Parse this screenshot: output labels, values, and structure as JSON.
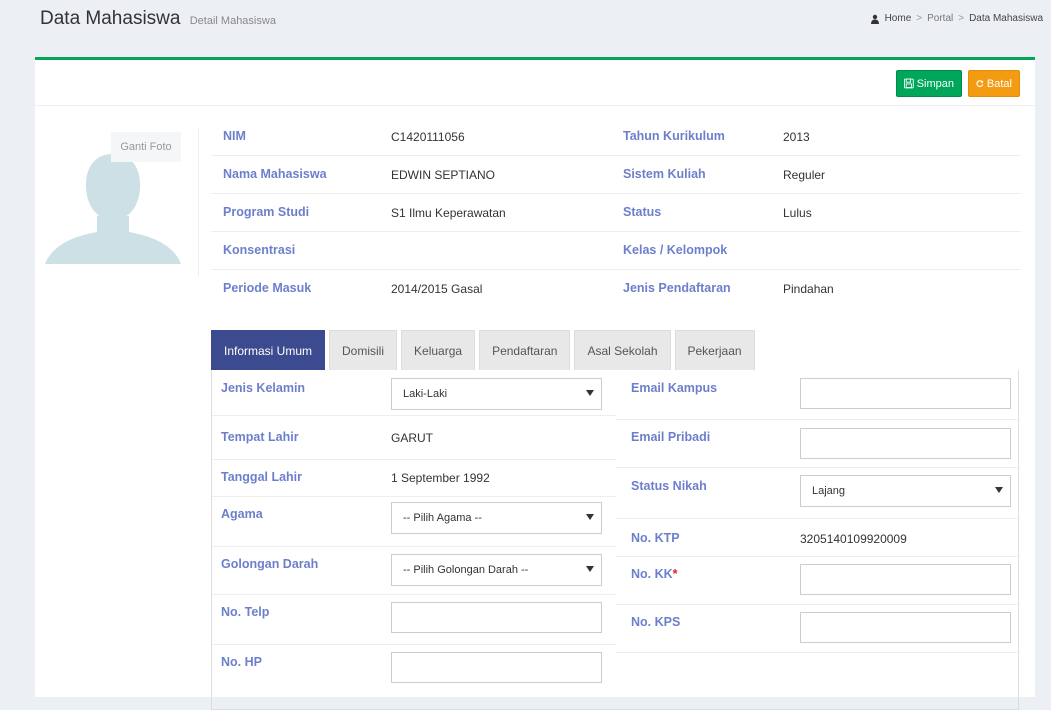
{
  "header": {
    "title": "Data Mahasiswa",
    "subtitle": "Detail Mahasiswa",
    "breadcrumb": [
      "Home",
      "Portal",
      "Data Mahasiswa"
    ],
    "breadcrumb_sep": ">"
  },
  "toolbar": {
    "save_label": "Simpan",
    "cancel_label": "Batal"
  },
  "photo": {
    "change_label": "Ganti Foto"
  },
  "info": {
    "nim_label": "NIM",
    "nim": "C1420111056",
    "tahun_label": "Tahun Kurikulum",
    "tahun": "2013",
    "nama_label": "Nama Mahasiswa",
    "nama": "EDWIN SEPTIANO",
    "sistem_label": "Sistem Kuliah",
    "sistem": "Reguler",
    "prodi_label": "Program Studi",
    "prodi": "S1 Ilmu Keperawatan",
    "status_label": "Status",
    "status": "Lulus",
    "konsentrasi_label": "Konsentrasi",
    "konsentrasi": "",
    "kelas_label": "Kelas / Kelompok",
    "kelas": "",
    "periode_label": "Periode Masuk",
    "periode": "2014/2015 Gasal",
    "jenis_label": "Jenis Pendaftaran",
    "jenis": "Pindahan"
  },
  "tabs": [
    "Informasi Umum",
    "Domisili",
    "Keluarga",
    "Pendaftaran",
    "Asal Sekolah",
    "Pekerjaan"
  ],
  "form_left": {
    "jk_label": "Jenis Kelamin",
    "jk_value": "Laki-Laki",
    "tempat_label": "Tempat Lahir",
    "tempat": "GARUT",
    "tanggal_label": "Tanggal Lahir",
    "tanggal": "1 September 1992",
    "agama_label": "Agama",
    "agama_value": "-- Pilih Agama --",
    "goldar_label": "Golongan Darah",
    "goldar_value": "-- Pilih Golongan Darah --",
    "telp_label": "No. Telp",
    "telp": "",
    "hp_label": "No. HP",
    "hp": ""
  },
  "form_right": {
    "email_kampus_label": "Email Kampus",
    "email_kampus": "",
    "email_pribadi_label": "Email Pribadi",
    "email_pribadi": "",
    "nikah_label": "Status Nikah",
    "nikah_value": "Lajang",
    "ktp_label": "No. KTP",
    "ktp": "3205140109920009",
    "kk_label": "No. KK",
    "kk_required": "*",
    "kk": "",
    "kps_label": "No. KPS",
    "kps": ""
  },
  "colors": {
    "accent_green": "#00a65a",
    "accent_orange": "#f39c12",
    "tab_active": "#3c4a8f",
    "label": "#6d7fcc"
  }
}
